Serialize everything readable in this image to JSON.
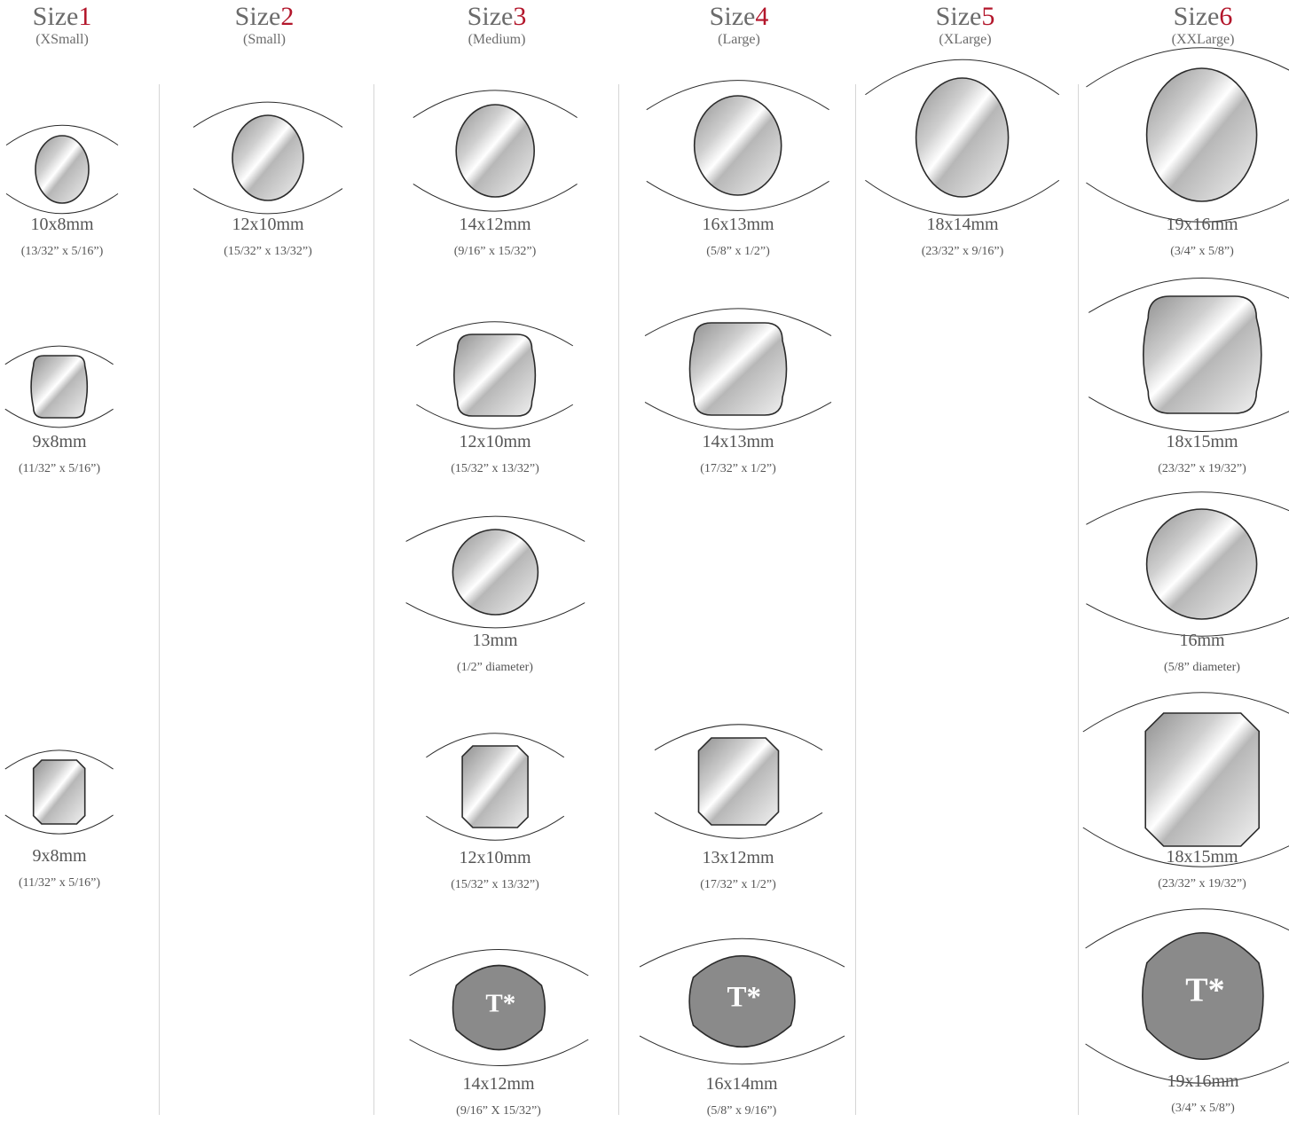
{
  "columns": [
    {
      "label": "Size",
      "number": "1",
      "sub": "(XSmall)"
    },
    {
      "label": "Size",
      "number": "2",
      "sub": "(Small)"
    },
    {
      "label": "Size",
      "number": "3",
      "sub": "(Medium)"
    },
    {
      "label": "Size",
      "number": "4",
      "sub": "(Large)"
    },
    {
      "label": "Size",
      "number": "5",
      "sub": "(XLarge)"
    },
    {
      "label": "Size",
      "number": "6",
      "sub": "(XXLarge)"
    }
  ],
  "items": [
    {
      "col": 1,
      "shape": "oval",
      "mm": "10x8mm",
      "inch": "(13/32” x 5/16”)"
    },
    {
      "col": 1,
      "shape": "cushion",
      "mm": "9x8mm",
      "inch": "(11/32” x 5/16”)"
    },
    {
      "col": 1,
      "shape": "octagon",
      "mm": "9x8mm",
      "inch": "(11/32” x 5/16”)"
    },
    {
      "col": 2,
      "shape": "oval",
      "mm": "12x10mm",
      "inch": "(15/32” x 13/32”)"
    },
    {
      "col": 3,
      "shape": "oval",
      "mm": "14x12mm",
      "inch": "(9/16” x 15/32”)"
    },
    {
      "col": 3,
      "shape": "cushion",
      "mm": "12x10mm",
      "inch": "(15/32” x 13/32”)"
    },
    {
      "col": 3,
      "shape": "round",
      "mm": "13mm",
      "inch": "(1/2” diameter)"
    },
    {
      "col": 3,
      "shape": "octagon",
      "mm": "12x10mm",
      "inch": "(15/32” x 13/32”)"
    },
    {
      "col": 3,
      "shape": "tablet",
      "badge": "T*",
      "mm": "14x12mm",
      "inch": "(9/16” X 15/32”)"
    },
    {
      "col": 4,
      "shape": "oval",
      "mm": "16x13mm",
      "inch": "(5/8” x 1/2”)"
    },
    {
      "col": 4,
      "shape": "cushion",
      "mm": "14x13mm",
      "inch": "(17/32” x 1/2”)"
    },
    {
      "col": 4,
      "shape": "octagon",
      "mm": "13x12mm",
      "inch": "(17/32” x 1/2”)"
    },
    {
      "col": 4,
      "shape": "tablet",
      "badge": "T*",
      "mm": "16x14mm",
      "inch": "(5/8” x 9/16”)"
    },
    {
      "col": 5,
      "shape": "oval",
      "mm": "18x14mm",
      "inch": "(23/32” x 9/16”)"
    },
    {
      "col": 6,
      "shape": "oval",
      "mm": "19x16mm",
      "inch": "(3/4” x 5/8”)"
    },
    {
      "col": 6,
      "shape": "cushion",
      "mm": "18x15mm",
      "inch": "(23/32” x 19/32”)"
    },
    {
      "col": 6,
      "shape": "round",
      "mm": "16mm",
      "inch": "(5/8” diameter)"
    },
    {
      "col": 6,
      "shape": "octagon",
      "mm": "18x15mm",
      "inch": "(23/32” x 19/32”)"
    },
    {
      "col": 6,
      "shape": "tablet",
      "badge": "T*",
      "mm": "19x16mm",
      "inch": "(3/4” x 5/8”)"
    }
  ],
  "colors": {
    "accent": "#b3162b",
    "text": "#555555",
    "outline": "#2b2b2b",
    "tablet_fill": "#8a8a8a",
    "divider": "#d6d6d6"
  }
}
